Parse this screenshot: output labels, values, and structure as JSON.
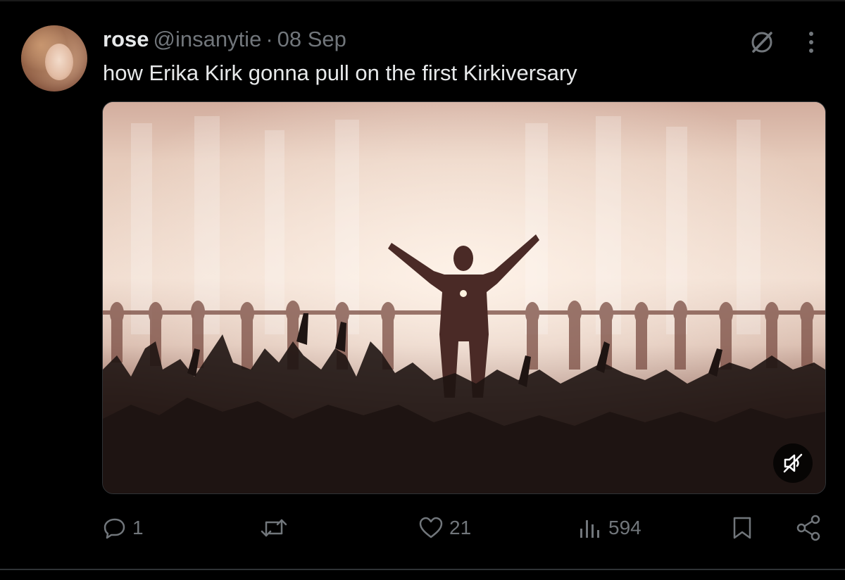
{
  "author": {
    "name": "rose",
    "handle": "@insanytie",
    "separator": "·",
    "date": "08 Sep",
    "avatar_icon": "profile-photo"
  },
  "tweet": {
    "text": "how Erika Kirk gonna pull on the first Kirkiversary"
  },
  "header_icons": {
    "grok": "grok-icon",
    "more": "more-icon"
  },
  "media": {
    "type": "video",
    "mute_icon": "muted-speaker-icon"
  },
  "actions": {
    "reply_count": "1",
    "retweet_count": "",
    "like_count": "21",
    "views_count": "594"
  },
  "colors": {
    "background": "#000000",
    "primary_text": "#e7e9ea",
    "secondary_text": "#71767b",
    "divider": "#2f3336"
  }
}
